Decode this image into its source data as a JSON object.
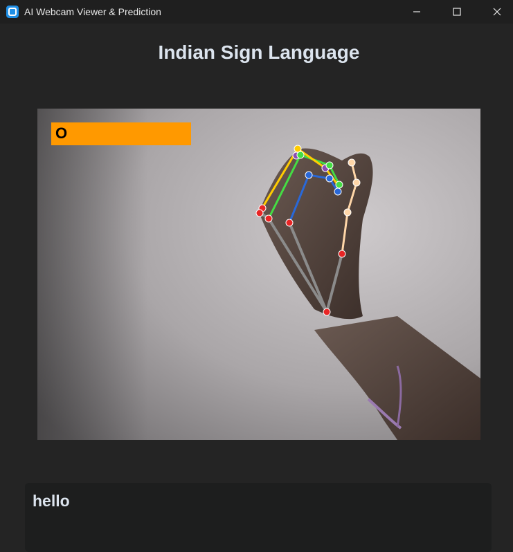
{
  "window": {
    "title": "AI Webcam Viewer & Prediction",
    "icon": "app-icon",
    "controls": [
      "minimize-icon",
      "maximize-icon",
      "close-icon"
    ]
  },
  "header": {
    "title": "Indian Sign Language"
  },
  "webcam": {
    "prediction_label": "O",
    "label_color": "#ff9900",
    "landmark_colors": {
      "joint": "#e82525",
      "palm": "#8b8b8b",
      "thumb": "#ffd6a8",
      "index": "#2968d8",
      "middle": "#44dd44",
      "ring": "#ffcc00",
      "pinky": "#ffcc00"
    }
  },
  "output": {
    "text": "hello"
  },
  "colors": {
    "background": "#242424",
    "titlebar": "#1f1f1f",
    "textbox": "#1d1e1e",
    "text": "#dce4ee"
  }
}
